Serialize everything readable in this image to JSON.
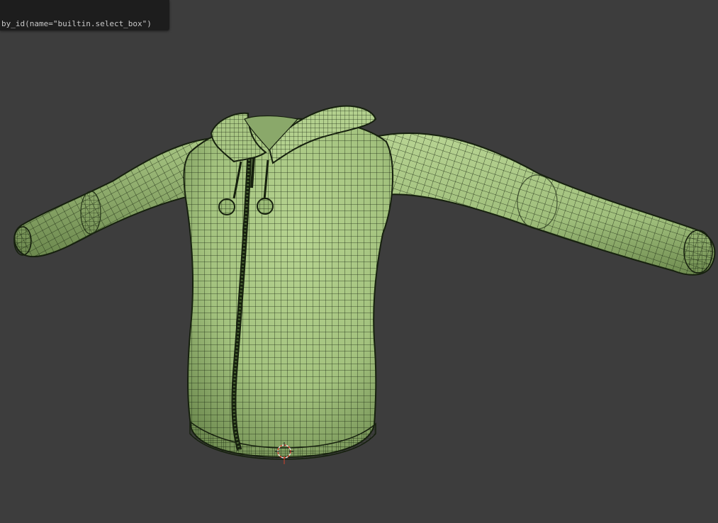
{
  "tooltip": {
    "python_text": "by_id(name=\"builtin.select_box\")"
  },
  "viewport": {
    "background_color": "#3d3d3d",
    "object": "hoodie-jacket-mesh",
    "object_color": "#a3c27e",
    "wire_color": "#1c2a12",
    "display_mode": "solid-with-wireframe",
    "cursor_icon": "3d-cursor-icon"
  }
}
